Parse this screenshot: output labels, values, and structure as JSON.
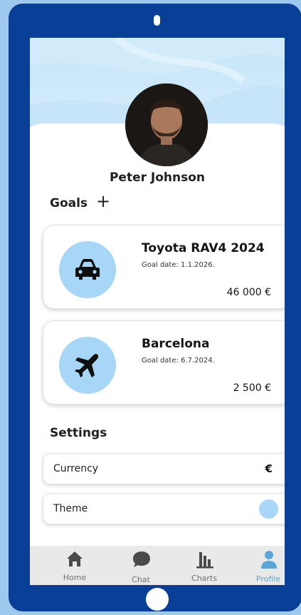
{
  "user": {
    "name": "Peter Johnson"
  },
  "goals": {
    "title": "Goals",
    "add_icon": "+",
    "items": [
      {
        "icon": "car-icon",
        "name": "Toyota RAV4 2024",
        "date": "Goal date: 1.1.2026.",
        "amount": "46 000 €"
      },
      {
        "icon": "airplane-icon",
        "name": "Barcelona",
        "date": "Goal date: 6.7.2024.",
        "amount": "2 500 €"
      }
    ]
  },
  "settings": {
    "title": "Settings",
    "currency_label": "Currency",
    "currency_value": "€",
    "theme_label": "Theme",
    "theme_color": "#a9d5f6"
  },
  "nav": {
    "home": "Home",
    "chat": "Chat",
    "charts": "Charts",
    "profile": "Profile"
  },
  "colors": {
    "device_frame": "#0a3f97",
    "accent": "#5aa6d8",
    "icon_circle": "#a7d6f7"
  }
}
